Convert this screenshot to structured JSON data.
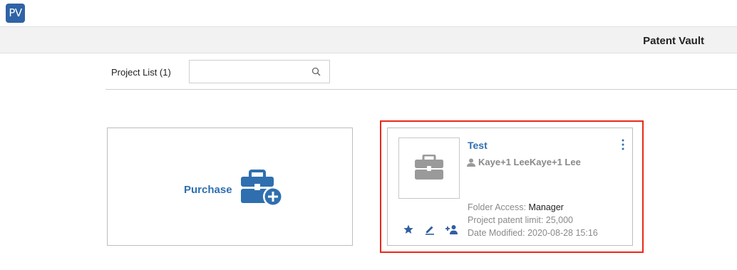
{
  "app": {
    "logo_text": "PV",
    "title": "Patent Vault",
    "brand_color": "#2f63a6"
  },
  "toolbar": {
    "project_list_label": "Project List (1)",
    "search": {
      "value": "",
      "placeholder": "",
      "icon": "search-icon"
    }
  },
  "purchase_card": {
    "label": "Purchase",
    "icon": "briefcase-plus-icon",
    "accent": "#2f6faf"
  },
  "project_card": {
    "name": "Test",
    "owner": "Kaye+1 LeeKaye+1 Lee",
    "owner_icon": "person-icon",
    "thumbnail_icon": "briefcase-icon",
    "folder_access_label": "Folder Access:",
    "folder_access_value": "Manager",
    "patent_limit": "Project patent limit: 25,000",
    "date_modified": "Date Modified: 2020-08-28 15:16",
    "actions": [
      "star-icon",
      "edit-icon",
      "add-user-icon"
    ],
    "highlight_color": "#e8291c"
  }
}
